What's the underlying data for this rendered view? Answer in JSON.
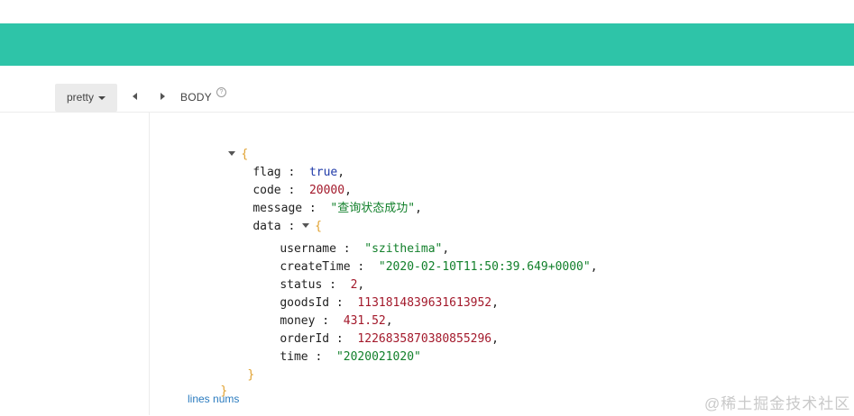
{
  "toolbar": {
    "format_label": "pretty",
    "section_label": "BODY",
    "help_symbol": "?"
  },
  "json_view": {
    "open_brace": "{",
    "close_brace": "}",
    "fields": [
      {
        "key": "flag",
        "value": "true",
        "type": "bool"
      },
      {
        "key": "code",
        "value": "20000",
        "type": "num"
      },
      {
        "key": "message",
        "value": "\"查询状态成功\"",
        "type": "str"
      },
      {
        "key": "data",
        "type": "object"
      }
    ],
    "data_fields": [
      {
        "key": "username",
        "value": "\"szitheima\"",
        "type": "str"
      },
      {
        "key": "createTime",
        "value": "\"2020-02-10T11:50:39.649+0000\"",
        "type": "str"
      },
      {
        "key": "status",
        "value": "2",
        "type": "num"
      },
      {
        "key": "goodsId",
        "value": "1131814839631613952",
        "type": "num"
      },
      {
        "key": "money",
        "value": "431.52",
        "type": "num"
      },
      {
        "key": "orderId",
        "value": "1226835870380855296",
        "type": "num"
      },
      {
        "key": "time",
        "value": "\"2020021020\"",
        "type": "str"
      }
    ]
  },
  "footer": {
    "lines_nums_label": "lines nums",
    "watermark": "@稀土掘金技术社区"
  },
  "colors": {
    "header_bar": "#2ec4a8",
    "brace": "#e0a12f",
    "bool": "#1f3aa8",
    "number": "#a3192b",
    "string": "#12802b",
    "link": "#2a7bbf"
  },
  "icons": {
    "format_dropdown": "caret-down-icon",
    "nav_prev": "triangle-left-icon",
    "nav_next": "triangle-right-icon",
    "help": "question-circle-icon",
    "collapse": "triangle-down-icon"
  }
}
